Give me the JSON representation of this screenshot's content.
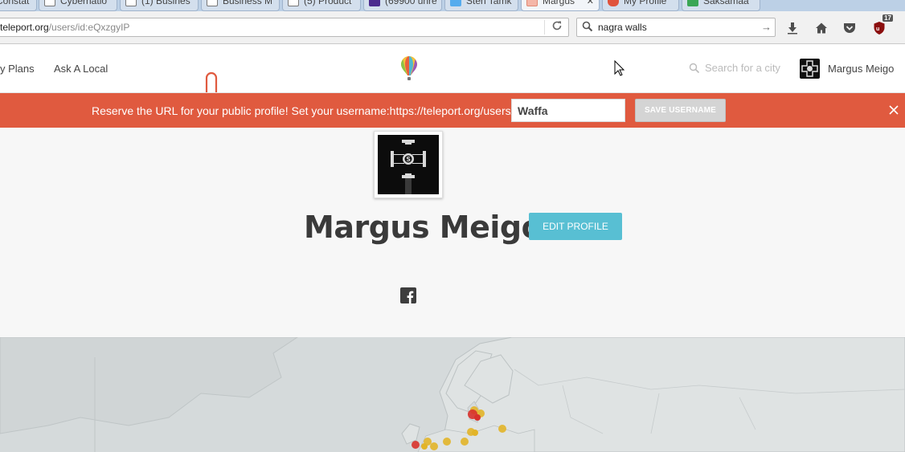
{
  "browser": {
    "tabs": [
      {
        "label": "Constat"
      },
      {
        "label": "Cybernatio"
      },
      {
        "label": "(1) Busines"
      },
      {
        "label": "Business M"
      },
      {
        "label": "(5) Product"
      },
      {
        "label": "(69900 unre"
      },
      {
        "label": "Sten Tamk"
      },
      {
        "label": "Margus",
        "active": true,
        "close": "✕"
      },
      {
        "label": "My Profile"
      },
      {
        "label": "Saksamaa"
      }
    ],
    "url_host": "teleport.org",
    "url_path": "/users/id:eQxzgyIP",
    "search_value": "nagra walls",
    "addon_badge": "17"
  },
  "header": {
    "nav_left": [
      "y Plans",
      "Ask A Local"
    ],
    "city_search_placeholder": "Search for a city",
    "username": "Margus Meigo"
  },
  "banner": {
    "text": "Reserve the URL for your public profile! Set your username:https://teleport.org/users/",
    "username_value": "Waffa",
    "save_label": "SAVE USERNAME"
  },
  "profile": {
    "name": "Margus Meigo",
    "edit_label": "EDIT PROFILE"
  },
  "colors": {
    "banner": "#e05a3f",
    "edit_button": "#58bfd3",
    "map_marker_yellow": "#e2b428",
    "map_marker_red": "#d8312b"
  }
}
